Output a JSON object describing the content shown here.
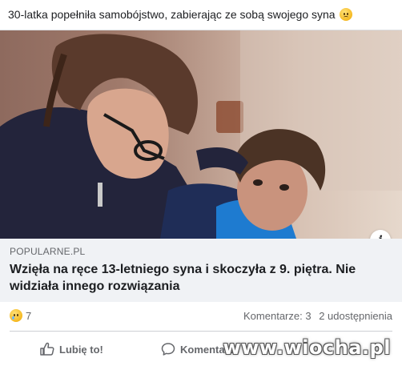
{
  "post": {
    "text": "30-latka popełniła samobójstwo, zabierając ze sobą swojego syna",
    "emoji": "sad-face-icon"
  },
  "link_card": {
    "domain": "POPULARNE.PL",
    "title": "Wzięła na ręce 13-letniego syna i skoczyła z 9. piętra. Nie widziała innego rozwiązania",
    "info_label": "i"
  },
  "stats": {
    "reaction_icon": "sad-reaction-icon",
    "reaction_count": "7",
    "comments": "Komentarze: 3",
    "shares": "2 udostępnienia"
  },
  "actions": {
    "like_label": "Lubię to!",
    "comment_label": "Komentarze"
  },
  "watermark": "www.wiocha.pl",
  "colors": {
    "text": "#1c1e21",
    "muted": "#65676b",
    "card_bg": "#f0f2f5",
    "border": "#dadde1"
  }
}
